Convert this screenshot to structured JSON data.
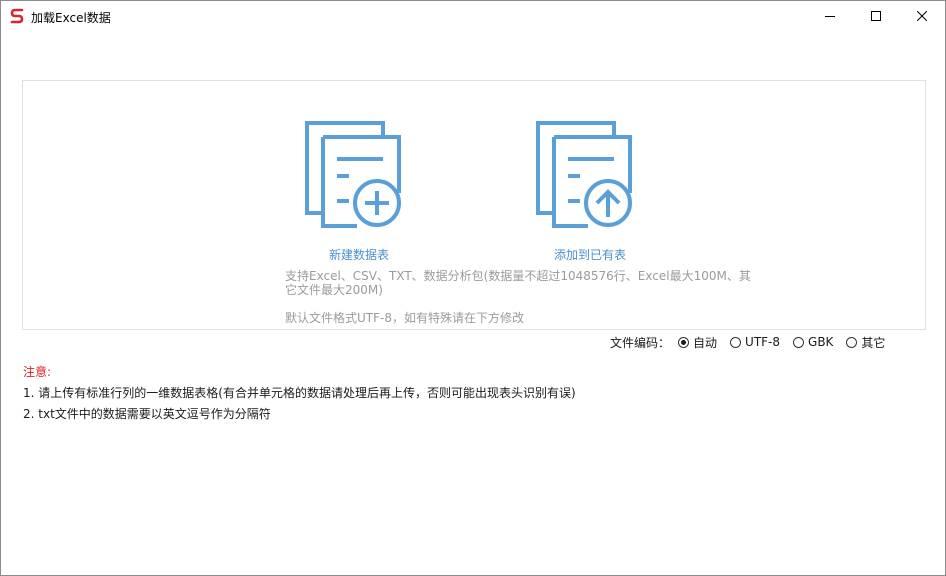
{
  "window": {
    "title": "加载Excel数据",
    "logo_icon": "app-logo-icon",
    "controls": [
      "minimize-icon",
      "maximize-icon",
      "close-icon"
    ]
  },
  "actions": {
    "new_table_label": "新建数据表",
    "new_table_icon": "document-plus-icon",
    "append_label": "添加到已有表",
    "append_icon": "document-upload-icon",
    "icon_color": "#5b9fd8"
  },
  "support_text": "支持Excel、CSV、TXT、数据分析包(数据量不超过1048576行、Excel最大100M、其它文件最大200M)",
  "encoding_default_text": "默认文件格式UTF-8，如有特殊请在下方修改",
  "encoding": {
    "label": "文件编码：",
    "selected": "自动",
    "options": [
      "自动",
      "UTF-8",
      "GBK",
      "其它"
    ]
  },
  "notes": {
    "title": "注意:",
    "items": [
      "1. 请上传有标准行列的一维数据表格(有合并单元格的数据请处理后再上传，否则可能出现表头识别有误)",
      "2. txt文件中的数据需要以英文逗号作为分隔符"
    ],
    "title_color": "#e02020"
  }
}
